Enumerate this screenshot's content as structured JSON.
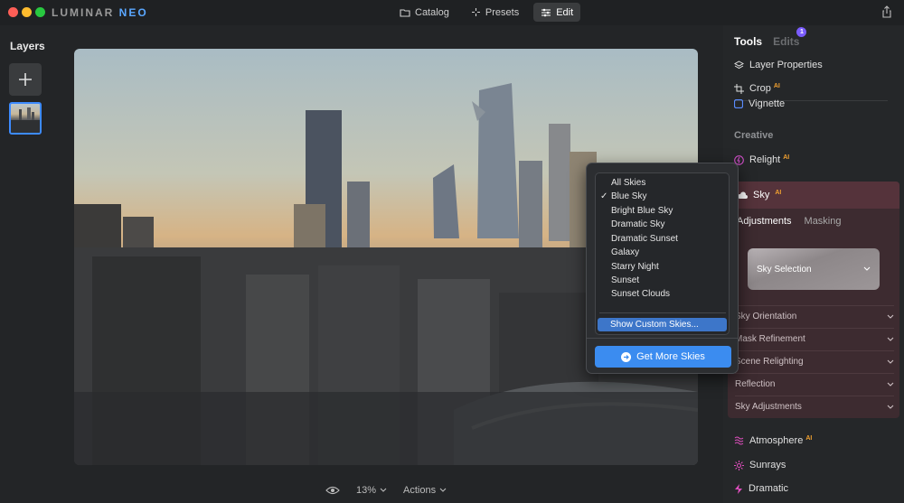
{
  "app": {
    "logo_main": "LUMINAR ",
    "logo_accent": "NEO"
  },
  "topnav": {
    "catalog": "Catalog",
    "presets": "Presets",
    "edit": "Edit"
  },
  "layers": {
    "title": "Layers"
  },
  "bottombar": {
    "zoom": "13%",
    "actions": "Actions"
  },
  "tools": {
    "tab_tools": "Tools",
    "tab_edits": "Edits",
    "edits_badge": "1",
    "layer_properties": "Layer Properties",
    "crop": "Crop",
    "crop_badge": "AI",
    "vignette": "Vignette",
    "section_creative": "Creative",
    "relight": "Relight",
    "relight_badge": "AI",
    "atmosphere": "Atmosphere",
    "atmosphere_badge": "AI",
    "sunrays": "Sunrays",
    "dramatic": "Dramatic"
  },
  "sky": {
    "title": "Sky",
    "title_badge": "AI",
    "tab_adjustments": "Adjustments",
    "tab_masking": "Masking",
    "selection_label": "Sky Selection",
    "sections": [
      "Sky Orientation",
      "Mask Refinement",
      "Scene Relighting",
      "Reflection",
      "Sky Adjustments"
    ]
  },
  "dropdown": {
    "options": [
      "All Skies",
      "Blue Sky",
      "Bright Blue Sky",
      "Dramatic Sky",
      "Dramatic Sunset",
      "Galaxy",
      "Starry Night",
      "Sunset",
      "Sunset Clouds"
    ],
    "checked_index": 1,
    "show_custom": "Show Custom Skies...",
    "get_more": "Get More Skies"
  },
  "colors": {
    "accent": "#3b8cf0",
    "sky_panel": "#3d2b30",
    "ai_badge": "#f0a030"
  }
}
